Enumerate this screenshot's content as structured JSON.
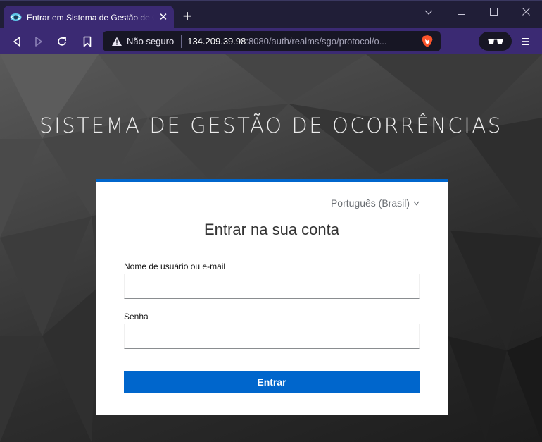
{
  "browser": {
    "tab": {
      "title": "Entrar em Sistema de Gestão de Ocorrências"
    },
    "url": {
      "security_label": "Não seguro",
      "host": "134.209.39.98",
      "rest": ":8080/auth/realms/sgo/protocol/o..."
    },
    "icons": {
      "back": "back-icon",
      "forward": "forward-icon",
      "reload": "reload-icon",
      "bookmark": "bookmark-icon",
      "warning": "warning-icon",
      "brave": "brave-shields-icon",
      "private": "glasses-icon",
      "menu": "menu-icon"
    },
    "colors": {
      "frame": "#201e37",
      "toolbar": "#3b2a73",
      "urlbar": "#171624"
    }
  },
  "page": {
    "heading": "SISTEMA DE GESTÃO DE OCORRÊNCIAS",
    "login": {
      "language": "Português (Brasil)",
      "title": "Entrar na sua conta",
      "username_label": "Nome de usuário ou e-mail",
      "username_value": "",
      "password_label": "Senha",
      "password_value": "",
      "submit_label": "Entrar"
    },
    "colors": {
      "accent": "#0066cc",
      "card": "#ffffff"
    }
  }
}
